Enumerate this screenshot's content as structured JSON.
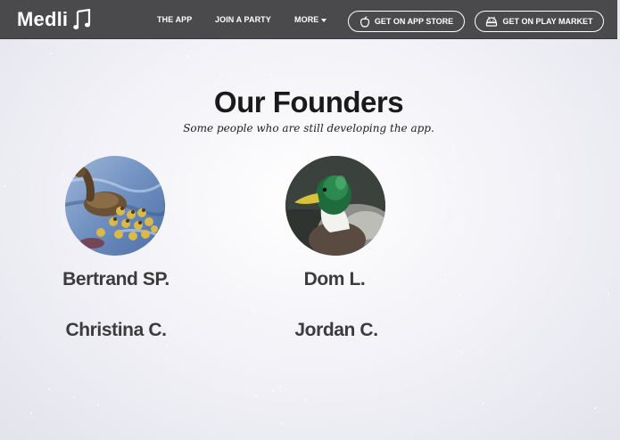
{
  "navbar": {
    "brand": "Medli",
    "links": [
      "THE APP",
      "JOIN A PARTY",
      "MORE"
    ],
    "app_store_label": "GET ON APP STORE",
    "play_market_label": "GET ON PLAY MARKET",
    "background_color": "#4a4a4c"
  },
  "page": {
    "title": "Our Founders",
    "subtitle": "Some people who are still developing the app."
  },
  "founders": [
    {
      "name": "Bertrand SP.",
      "photo": "duck-with-ducklings"
    },
    {
      "name": "Dom L.",
      "photo": "mallard-duck"
    },
    {
      "name": "Christina C."
    },
    {
      "name": "Jordan C."
    }
  ]
}
